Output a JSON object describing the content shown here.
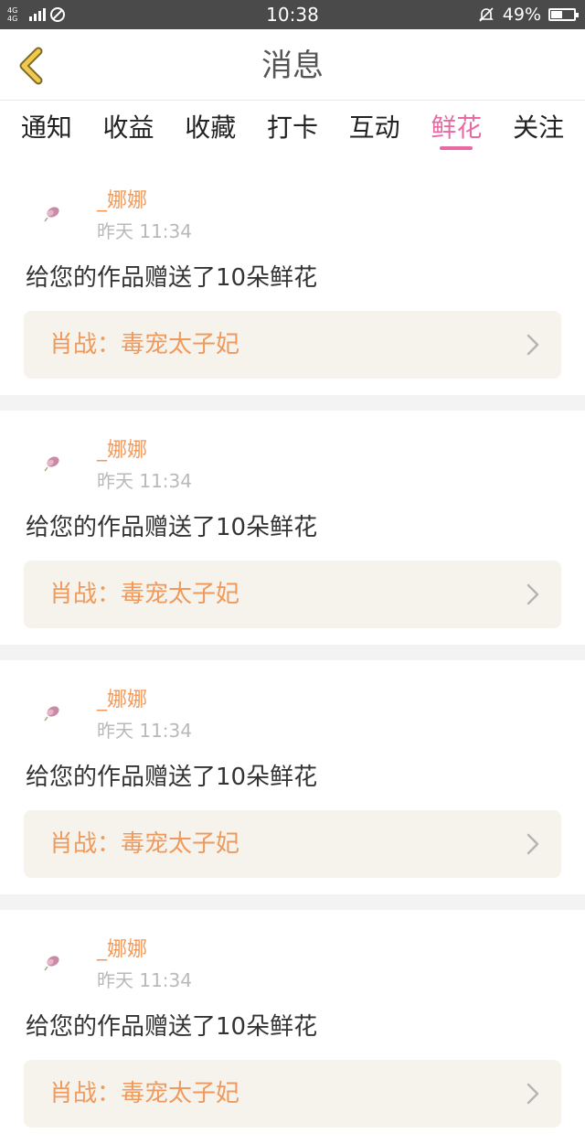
{
  "status_bar": {
    "network": "4G 4G",
    "time": "10:38",
    "battery_percent": "49%",
    "battery_level": 0.49
  },
  "header": {
    "title": "消息",
    "back_icon": "chevron-left-icon",
    "accent_color": "#f2c94c"
  },
  "tabs": [
    {
      "label": "通知",
      "active": false
    },
    {
      "label": "收益",
      "active": false
    },
    {
      "label": "收藏",
      "active": false
    },
    {
      "label": "打卡",
      "active": false
    },
    {
      "label": "互动",
      "active": false
    },
    {
      "label": "鲜花",
      "active": true
    },
    {
      "label": "关注",
      "active": false
    }
  ],
  "colors": {
    "active_tab": "#e76aa2",
    "name_and_title": "#ef9a5c",
    "timestamp": "#b9b9b9"
  },
  "messages": [
    {
      "user": "_娜娜",
      "time": "昨天 11:34",
      "text": "给您的作品赠送了10朵鲜花",
      "work_title": "肖战：毒宠太子妃"
    },
    {
      "user": "_娜娜",
      "time": "昨天 11:34",
      "text": "给您的作品赠送了10朵鲜花",
      "work_title": "肖战：毒宠太子妃"
    },
    {
      "user": "_娜娜",
      "time": "昨天 11:34",
      "text": "给您的作品赠送了10朵鲜花",
      "work_title": "肖战：毒宠太子妃"
    },
    {
      "user": "_娜娜",
      "time": "昨天 11:34",
      "text": "给您的作品赠送了10朵鲜花",
      "work_title": "肖战：毒宠太子妃"
    }
  ]
}
